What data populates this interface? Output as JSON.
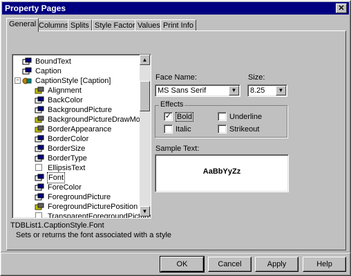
{
  "window": {
    "title": "Property Pages",
    "close_label": "✕"
  },
  "tabs": [
    {
      "label": "General",
      "active": true
    },
    {
      "label": "Columns"
    },
    {
      "label": "Splits"
    },
    {
      "label": "Style Factory"
    },
    {
      "label": "Values"
    },
    {
      "label": "Print Info"
    }
  ],
  "tree": {
    "items": [
      {
        "label": "BoundText",
        "icon": "property-icon"
      },
      {
        "label": "Caption",
        "icon": "property-icon"
      },
      {
        "label": "CaptionStyle [Caption]",
        "icon": "style-object-icon",
        "expander": "−"
      },
      {
        "label": "Alignment",
        "icon": "enum-property-icon"
      },
      {
        "label": "BackColor",
        "icon": "property-icon"
      },
      {
        "label": "BackgroundPicture",
        "icon": "property-icon"
      },
      {
        "label": "BackgroundPictureDrawMode",
        "icon": "enum-property-icon"
      },
      {
        "label": "BorderAppearance",
        "icon": "enum-property-icon"
      },
      {
        "label": "BorderColor",
        "icon": "property-icon"
      },
      {
        "label": "BorderSize",
        "icon": "property-icon"
      },
      {
        "label": "BorderType",
        "icon": "property-icon"
      },
      {
        "label": "EllipsisText",
        "icon": "checkbox-property-icon"
      },
      {
        "label": "Font",
        "icon": "property-icon",
        "selected": true
      },
      {
        "label": "ForeColor",
        "icon": "property-icon"
      },
      {
        "label": "ForegroundPicture",
        "icon": "property-icon"
      },
      {
        "label": "ForegroundPicturePosition",
        "icon": "enum-property-icon"
      },
      {
        "label": "TransparentForegroundPicture",
        "icon": "checkbox-property-icon"
      }
    ]
  },
  "description": {
    "path": "TDBList1.CaptionStyle.Font",
    "text": "Sets or returns the font associated with a style"
  },
  "font": {
    "face_label": "Face Name:",
    "face_value": "MS Sans Serif",
    "size_label": "Size:",
    "size_value": "8.25",
    "effects_label": "Effects",
    "effects": [
      {
        "label": "Bold",
        "checked": true
      },
      {
        "label": "Underline",
        "checked": false
      },
      {
        "label": "Italic",
        "checked": false
      },
      {
        "label": "Strikeout",
        "checked": false
      }
    ],
    "sample_label": "Sample Text:",
    "sample_text": "AaBbYyZz"
  },
  "buttons": {
    "ok": "OK",
    "cancel": "Cancel",
    "apply": "Apply",
    "help": "Help"
  },
  "colors": {
    "titlebar": "#000080",
    "face": "#c0c0c0"
  }
}
